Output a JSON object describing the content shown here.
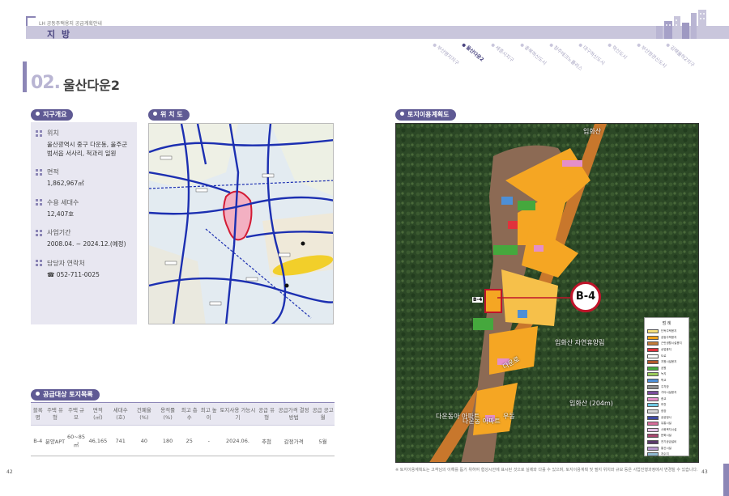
{
  "header": {
    "subtitle": "LH 공동주택용지 공급계획안내",
    "region": "지 방",
    "tabs": [
      "부산명지지구",
      "울산다운2",
      "세종시지구",
      "충북혁신도시",
      "청주테크노폴리스",
      "대구혁신도시",
      "혁신도시",
      "부산정관신도시",
      "김해율하2지구"
    ],
    "active_tab_index": 1
  },
  "section": {
    "number": "02.",
    "title": "울산다운2"
  },
  "overview": {
    "heading": "지구개요",
    "items": [
      {
        "label": "위치",
        "value": "울산광역시 중구 다운동, 울주군 범서읍 서사리, 척과리 일원"
      },
      {
        "label": "면적",
        "value": "1,862,967㎡"
      },
      {
        "label": "수용 세대수",
        "value": "12,407호"
      },
      {
        "label": "사업기간",
        "value": "2008.04. ~ 2024.12.(예정)"
      },
      {
        "label": "담당자 연락처",
        "value": "☎ 052-711-0025"
      }
    ]
  },
  "location_map": {
    "heading": "위 치 도"
  },
  "land_use_map": {
    "heading": "토지이용계획도",
    "badge": "B-4",
    "parcel_label": "B-4",
    "labels": [
      "입화산",
      "입화산 자연휴양림",
      "입화산 (204m)",
      "다운동 아파트",
      "다운동아 아파트",
      "다운로",
      "우동"
    ],
    "legend_title": "범 례",
    "legend": [
      {
        "name": "단독주택용지",
        "color": "#f6e07a"
      },
      {
        "name": "공동주택용지",
        "color": "#f1a21a"
      },
      {
        "name": "근린생활시설용지",
        "color": "#c27c3a"
      },
      {
        "name": "상업용지",
        "color": "#e0323c"
      },
      {
        "name": "도로",
        "color": "#ffffff"
      },
      {
        "name": "지원시설용지",
        "color": "#b3592c"
      },
      {
        "name": "공원",
        "color": "#45a83d"
      },
      {
        "name": "녹지",
        "color": "#9acb5a"
      },
      {
        "name": "학교",
        "color": "#4d8fd6"
      },
      {
        "name": "주차장",
        "color": "#8f8f8f"
      },
      {
        "name": "기타시설용지",
        "color": "#7a4c9c"
      },
      {
        "name": "종교",
        "color": "#e48fc9"
      },
      {
        "name": "하천",
        "color": "#6ec8e3"
      },
      {
        "name": "광장",
        "color": "#d9d9d9"
      },
      {
        "name": "공공청사",
        "color": "#3f4aa3"
      },
      {
        "name": "유통시설",
        "color": "#d66e9a"
      },
      {
        "name": "사회복지시설",
        "color": "#e4c3e6"
      },
      {
        "name": "문화시설",
        "color": "#a7476f"
      },
      {
        "name": "전기공급설비",
        "color": "#5b3a6b"
      },
      {
        "name": "통신시설",
        "color": "#b899cf"
      },
      {
        "name": "저수지",
        "color": "#8fb9d0"
      }
    ],
    "footnote": "※ 토지이용계획도는 고객님의 이해를 돕기 위하여 협성시안에 표시된 것으로 실제와 다를 수 있으며, 토지이용계획 및 필지 위치와 규모 등은 사업진행과정에서 변경될 수 있습니다."
  },
  "supply_table": {
    "heading": "공급대상 토지목록",
    "columns": [
      "블록명",
      "주택 유형",
      "주택 규모",
      "면적 (㎡)",
      "세대수 (호)",
      "건폐율 (%)",
      "용적률 (%)",
      "최고 층수",
      "최고 높이",
      "토지사용 가능시기",
      "공급 유형",
      "공급가격 결정방법",
      "공급 공고월"
    ],
    "rows": [
      [
        "B-4",
        "분양APT",
        "60~85㎡",
        "46,165",
        "741",
        "40",
        "180",
        "25",
        "-",
        "2024.06.",
        "추첨",
        "감정가격",
        "5월"
      ]
    ]
  },
  "pages": {
    "left": "42",
    "right": "43"
  },
  "colors": {
    "accent": "#5f5a94",
    "accent_light": "#c9c6dc",
    "panel": "#e8e7f1"
  }
}
